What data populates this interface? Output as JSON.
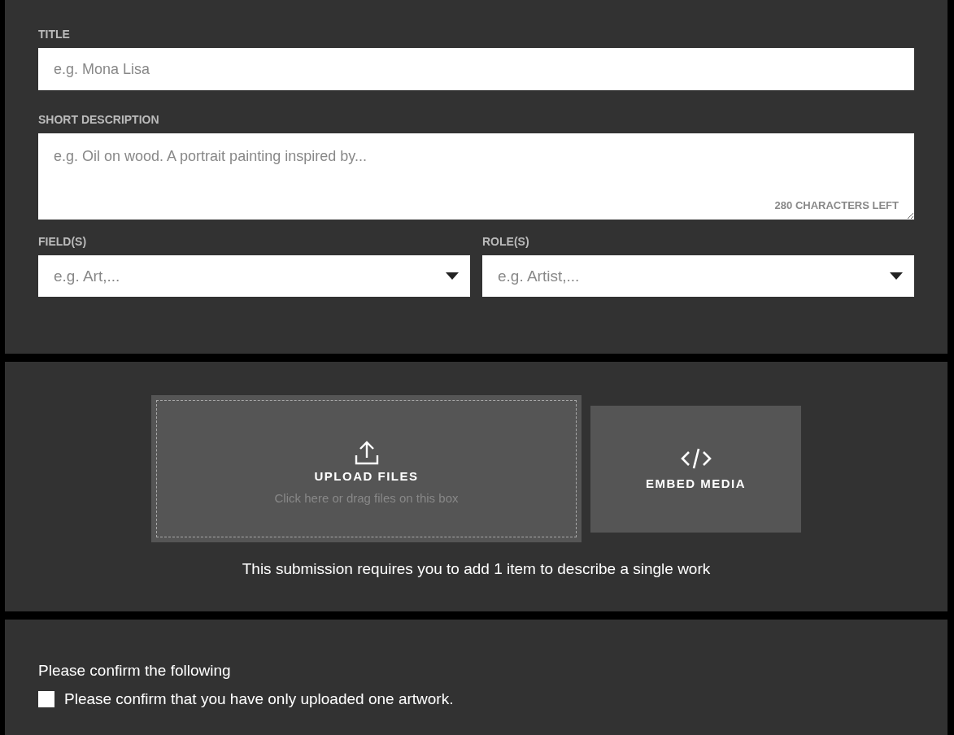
{
  "title_field": {
    "label": "TITLE",
    "placeholder": "e.g. Mona Lisa"
  },
  "description_field": {
    "label": "SHORT DESCRIPTION",
    "placeholder": "e.g. Oil on wood. A portrait painting inspired by...",
    "counter": "280 CHARACTERS LEFT"
  },
  "dropdowns": [
    {
      "label": "FIELD(S)",
      "placeholder": "e.g. Art,..."
    },
    {
      "label": "ROLE(S)",
      "placeholder": "e.g. Artist,..."
    }
  ],
  "upload": {
    "title": "UPLOAD FILES",
    "hint": "Click here or drag files on this box"
  },
  "embed": {
    "title": "EMBED MEDIA"
  },
  "requirement": "This submission requires you to add 1 item to describe a single work",
  "confirm": {
    "heading": "Please confirm the following",
    "items": [
      {
        "label": "Please confirm that you have only uploaded one artwork.",
        "checked": false
      }
    ]
  }
}
